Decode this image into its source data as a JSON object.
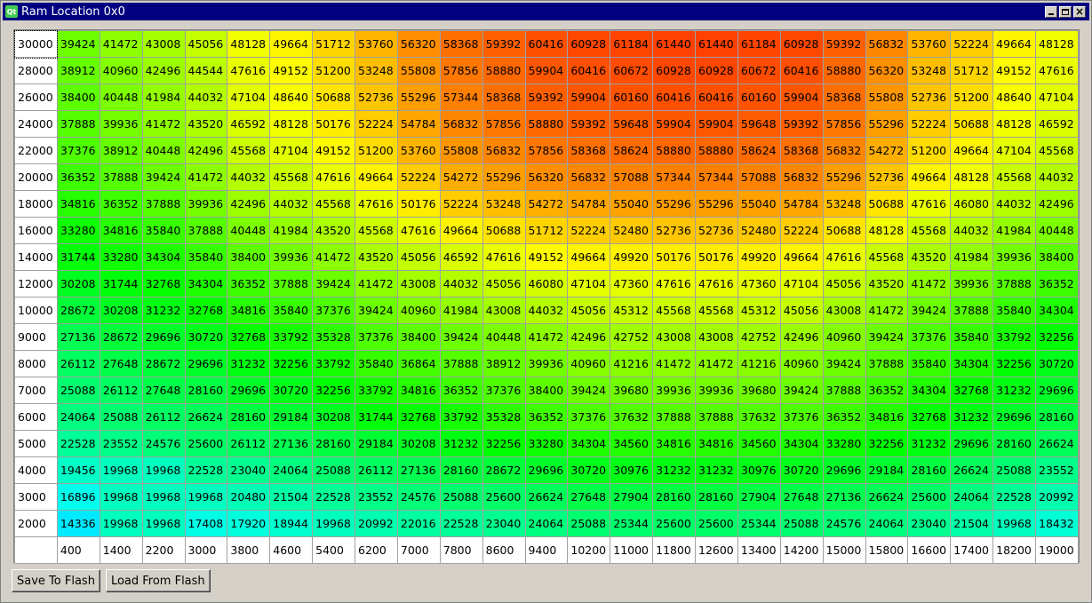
{
  "window": {
    "title": "Ram Location 0x0",
    "app_icon_text": "Qt",
    "controls": [
      "minimize",
      "maximize",
      "close"
    ]
  },
  "table": {
    "row_headers": [
      "30000",
      "28000",
      "26000",
      "24000",
      "22000",
      "20000",
      "18000",
      "16000",
      "14000",
      "12000",
      "10000",
      "9000",
      "8000",
      "7000",
      "6000",
      "5000",
      "4000",
      "3000",
      "2000"
    ],
    "col_headers": [
      "400",
      "1400",
      "2200",
      "3000",
      "3800",
      "4600",
      "5400",
      "6200",
      "7000",
      "7800",
      "8600",
      "9400",
      "10200",
      "11000",
      "11800",
      "12600",
      "13400",
      "14200",
      "15000",
      "15800",
      "16600",
      "17400",
      "18200",
      "19000"
    ],
    "value_range": [
      14336,
      61440
    ],
    "rows": [
      [
        39424,
        41472,
        43008,
        45056,
        48128,
        49664,
        51712,
        53760,
        56320,
        58368,
        59392,
        60416,
        60928,
        61184,
        61440,
        61440,
        61184,
        60928,
        59392,
        56832,
        53760,
        52224,
        49664,
        48128
      ],
      [
        38912,
        40960,
        42496,
        44544,
        47616,
        49152,
        51200,
        53248,
        55808,
        57856,
        58880,
        59904,
        60416,
        60672,
        60928,
        60928,
        60672,
        60416,
        58880,
        56320,
        53248,
        51712,
        49152,
        47616
      ],
      [
        38400,
        40448,
        41984,
        44032,
        47104,
        48640,
        50688,
        52736,
        55296,
        57344,
        58368,
        59392,
        59904,
        60160,
        60416,
        60416,
        60160,
        59904,
        58368,
        55808,
        52736,
        51200,
        48640,
        47104
      ],
      [
        37888,
        39936,
        41472,
        43520,
        46592,
        48128,
        50176,
        52224,
        54784,
        56832,
        57856,
        58880,
        59392,
        59648,
        59904,
        59904,
        59648,
        59392,
        57856,
        55296,
        52224,
        50688,
        48128,
        46592
      ],
      [
        37376,
        38912,
        40448,
        42496,
        45568,
        47104,
        49152,
        51200,
        53760,
        55808,
        56832,
        57856,
        58368,
        58624,
        58880,
        58880,
        58624,
        58368,
        56832,
        54272,
        51200,
        49664,
        47104,
        45568
      ],
      [
        36352,
        37888,
        39424,
        41472,
        44032,
        45568,
        47616,
        49664,
        52224,
        54272,
        55296,
        56320,
        56832,
        57088,
        57344,
        57344,
        57088,
        56832,
        55296,
        52736,
        49664,
        48128,
        45568,
        44032
      ],
      [
        34816,
        36352,
        37888,
        39936,
        42496,
        44032,
        45568,
        47616,
        50176,
        52224,
        53248,
        54272,
        54784,
        55040,
        55296,
        55296,
        55040,
        54784,
        53248,
        50688,
        47616,
        46080,
        44032,
        42496
      ],
      [
        33280,
        34816,
        35840,
        37888,
        40448,
        41984,
        43520,
        45568,
        47616,
        49664,
        50688,
        51712,
        52224,
        52480,
        52736,
        52736,
        52480,
        52224,
        50688,
        48128,
        45568,
        44032,
        41984,
        40448
      ],
      [
        31744,
        33280,
        34304,
        35840,
        38400,
        39936,
        41472,
        43520,
        45056,
        46592,
        47616,
        49152,
        49664,
        49920,
        50176,
        50176,
        49920,
        49664,
        47616,
        45568,
        43520,
        41984,
        39936,
        38400
      ],
      [
        30208,
        31744,
        32768,
        34304,
        36352,
        37888,
        39424,
        41472,
        43008,
        44032,
        45056,
        46080,
        47104,
        47360,
        47616,
        47616,
        47360,
        47104,
        45056,
        43520,
        41472,
        39936,
        37888,
        36352
      ],
      [
        28672,
        30208,
        31232,
        32768,
        34816,
        35840,
        37376,
        39424,
        40960,
        41984,
        43008,
        44032,
        45056,
        45312,
        45568,
        45568,
        45312,
        45056,
        43008,
        41472,
        39424,
        37888,
        35840,
        34304
      ],
      [
        27136,
        28672,
        29696,
        30720,
        32768,
        33792,
        35328,
        37376,
        38400,
        39424,
        40448,
        41472,
        42496,
        42752,
        43008,
        43008,
        42752,
        42496,
        40960,
        39424,
        37376,
        35840,
        33792,
        32256
      ],
      [
        26112,
        27648,
        28672,
        29696,
        31232,
        32256,
        33792,
        35840,
        36864,
        37888,
        38912,
        39936,
        40960,
        41216,
        41472,
        41472,
        41216,
        40960,
        39424,
        37888,
        35840,
        34304,
        32256,
        30720
      ],
      [
        25088,
        26112,
        27648,
        28160,
        29696,
        30720,
        32256,
        33792,
        34816,
        36352,
        37376,
        38400,
        39424,
        39680,
        39936,
        39936,
        39680,
        39424,
        37888,
        36352,
        34304,
        32768,
        31232,
        29696
      ],
      [
        24064,
        25088,
        26112,
        26624,
        28160,
        29184,
        30208,
        31744,
        32768,
        33792,
        35328,
        36352,
        37376,
        37632,
        37888,
        37888,
        37632,
        37376,
        36352,
        34816,
        32768,
        31232,
        29696,
        28160
      ],
      [
        22528,
        23552,
        24576,
        25600,
        26112,
        27136,
        28160,
        29184,
        30208,
        31232,
        32256,
        33280,
        34304,
        34560,
        34816,
        34816,
        34560,
        34304,
        33280,
        32256,
        31232,
        29696,
        28160,
        26624
      ],
      [
        19456,
        19968,
        19968,
        22528,
        23040,
        24064,
        25088,
        26112,
        27136,
        28160,
        28672,
        29696,
        30720,
        30976,
        31232,
        31232,
        30976,
        30720,
        29696,
        29184,
        28160,
        26624,
        25088,
        23552
      ],
      [
        16896,
        19968,
        19968,
        19968,
        20480,
        21504,
        22528,
        23552,
        24576,
        25088,
        25600,
        26624,
        27648,
        27904,
        28160,
        28160,
        27904,
        27648,
        27136,
        26624,
        25600,
        24064,
        22528,
        20992
      ],
      [
        14336,
        19968,
        19968,
        17408,
        17920,
        18944,
        19968,
        20992,
        22016,
        22528,
        23040,
        24064,
        25088,
        25344,
        25600,
        25600,
        25344,
        25088,
        24576,
        24064,
        23040,
        21504,
        19968,
        18432
      ]
    ]
  },
  "buttons": {
    "save_label": "Save To Flash",
    "load_label": "Load From Flash"
  }
}
